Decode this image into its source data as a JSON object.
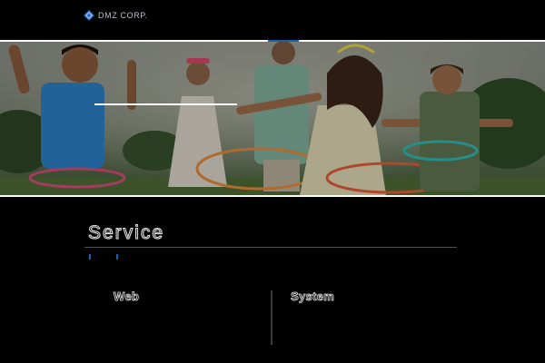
{
  "header": {
    "logo_text": "DMZ CORP.",
    "logo_icon": "diamond-logo-icon",
    "brand_color": "#1c5fae"
  },
  "hero": {
    "image_subject": "children playing with hula hoops on a lawn",
    "frame_color": "#ffffff"
  },
  "services": {
    "title": "Service",
    "items": [
      {
        "label": "Web"
      },
      {
        "label": "System"
      }
    ]
  }
}
